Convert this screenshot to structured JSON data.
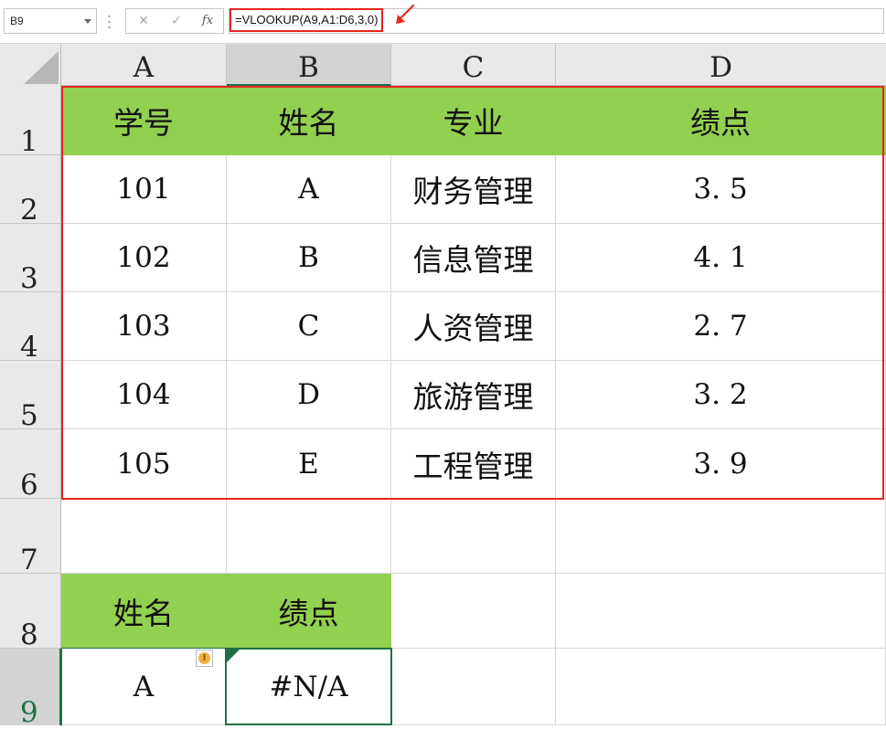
{
  "formula_bar": {
    "name_box": "B9",
    "cancel_glyph": "✕",
    "enter_glyph": "✓",
    "fx_label": "fx",
    "formula": "=VLOOKUP(A9,A1:D6,3,0)"
  },
  "columns": [
    "A",
    "B",
    "C",
    "D"
  ],
  "active_column": "B",
  "rows": [
    "1",
    "2",
    "3",
    "4",
    "5",
    "6",
    "7",
    "8",
    "9"
  ],
  "active_row": "9",
  "table": {
    "headers": [
      "学号",
      "姓名",
      "专业",
      "绩点"
    ],
    "records": [
      [
        "101",
        "A",
        "财务管理",
        "3. 5"
      ],
      [
        "102",
        "B",
        "信息管理",
        "4. 1"
      ],
      [
        "103",
        "C",
        "人资管理",
        "2. 7"
      ],
      [
        "104",
        "D",
        "旅游管理",
        "3. 2"
      ],
      [
        "105",
        "E",
        "工程管理",
        "3. 9"
      ]
    ]
  },
  "lookup": {
    "headers": [
      "姓名",
      "绩点"
    ],
    "values": [
      "A",
      "#N/A"
    ]
  },
  "colors": {
    "header_fill": "#92d050",
    "highlight_border": "#e8251c",
    "selection": "#1e7145"
  },
  "icons": {
    "error_indicator": "warning-icon",
    "annotation_arrow": "red-arrow-icon"
  }
}
